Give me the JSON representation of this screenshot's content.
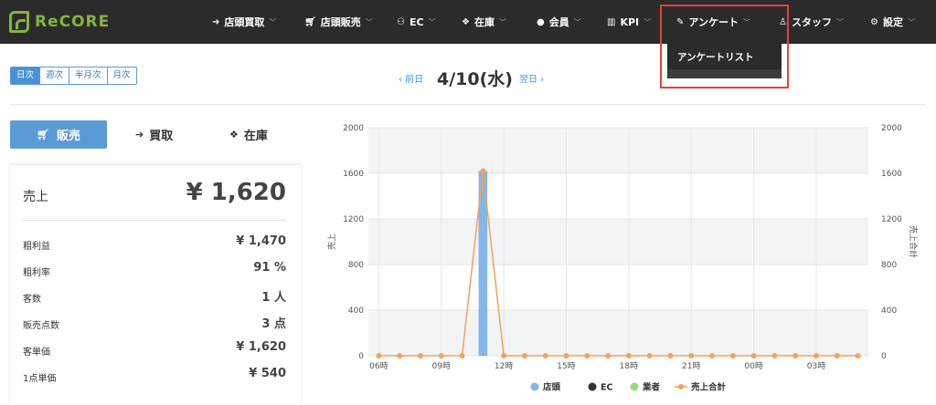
{
  "header": {
    "logo": "ReCORE",
    "nav": [
      {
        "label": "店頭買取",
        "icon": "sign-in-icon"
      },
      {
        "label": "店頭販売",
        "icon": "cart-icon"
      },
      {
        "label": "EC",
        "icon": "sitemap-icon"
      },
      {
        "label": "在庫",
        "icon": "cubes-icon"
      },
      {
        "label": "会員",
        "icon": "user-icon"
      },
      {
        "label": "KPI",
        "icon": "bar-chart-icon"
      },
      {
        "label": "アンケート",
        "icon": "edit-icon"
      },
      {
        "label": "スタッフ",
        "icon": "user-outline-icon"
      },
      {
        "label": "設定",
        "icon": "gear-icon"
      }
    ],
    "dropdown": {
      "item": "アンケートリスト"
    }
  },
  "period": {
    "options": [
      "日次",
      "週次",
      "半月次",
      "月次"
    ],
    "selected": "日次"
  },
  "datenav": {
    "prev": "‹ 前日",
    "current": "4/10(水)",
    "next": "翌日 ›"
  },
  "tabs": {
    "sales": "販売",
    "buy": "買取",
    "stock": "在庫"
  },
  "summary": {
    "sales_label": "売上",
    "sales_value": "¥ 1,620",
    "rows": [
      {
        "label": "粗利益",
        "value": "¥ 1,470"
      },
      {
        "label": "粗利率",
        "value": "91 %"
      },
      {
        "label": "客数",
        "value": "1 人"
      },
      {
        "label": "販売点数",
        "value": "3 点"
      },
      {
        "label": "客単価",
        "value": "¥ 1,620"
      },
      {
        "label": "1点単価",
        "value": "¥ 540"
      }
    ]
  },
  "colors": {
    "accent": "#5b9bd5",
    "line": "#f0a35e",
    "highlight": "#e0433a",
    "ec": "#333333",
    "gyosha": "#90e07a"
  },
  "chart_data": {
    "type": "bar",
    "x": [
      "06時",
      "07時",
      "08時",
      "09時",
      "10時",
      "11時",
      "12時",
      "13時",
      "14時",
      "15時",
      "16時",
      "17時",
      "18時",
      "19時",
      "20時",
      "21時",
      "22時",
      "23時",
      "00時",
      "01時",
      "02時",
      "03時",
      "04時",
      "05時"
    ],
    "x_tick_labels": [
      "06時",
      "09時",
      "12時",
      "15時",
      "18時",
      "21時",
      "00時",
      "03時"
    ],
    "ylabel": "売上",
    "ylabel_right": "売上合計",
    "ylim": [
      0,
      2000
    ],
    "yticks": [
      "0",
      "400",
      "800",
      "1200",
      "1600",
      "2000"
    ],
    "series": [
      {
        "name": "店頭",
        "type": "bar",
        "values": [
          0,
          0,
          0,
          0,
          0,
          1620,
          0,
          0,
          0,
          0,
          0,
          0,
          0,
          0,
          0,
          0,
          0,
          0,
          0,
          0,
          0,
          0,
          0,
          0
        ]
      },
      {
        "name": "EC",
        "type": "bar",
        "values": [
          0,
          0,
          0,
          0,
          0,
          0,
          0,
          0,
          0,
          0,
          0,
          0,
          0,
          0,
          0,
          0,
          0,
          0,
          0,
          0,
          0,
          0,
          0,
          0
        ]
      },
      {
        "name": "業者",
        "type": "bar",
        "values": [
          0,
          0,
          0,
          0,
          0,
          0,
          0,
          0,
          0,
          0,
          0,
          0,
          0,
          0,
          0,
          0,
          0,
          0,
          0,
          0,
          0,
          0,
          0,
          0
        ]
      },
      {
        "name": "売上合計",
        "type": "line",
        "values": [
          0,
          0,
          0,
          0,
          0,
          1620,
          0,
          0,
          0,
          0,
          0,
          0,
          0,
          0,
          0,
          0,
          0,
          0,
          0,
          0,
          0,
          0,
          0,
          0
        ]
      }
    ],
    "grid": true,
    "legend_position": "bottom"
  }
}
